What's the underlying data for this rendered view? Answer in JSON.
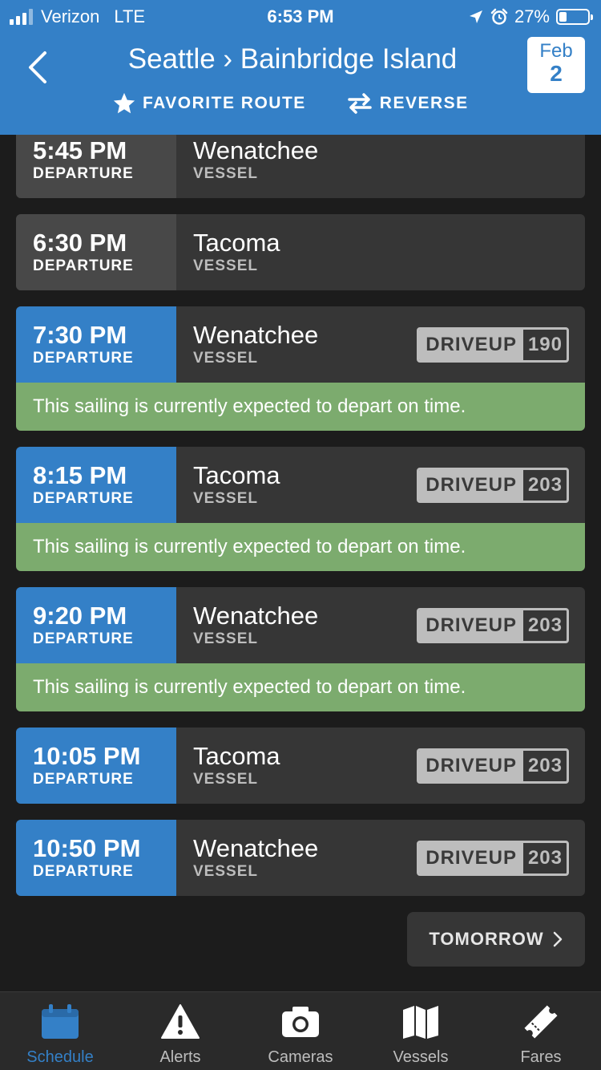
{
  "status_bar": {
    "carrier": "Verizon",
    "network": "LTE",
    "time": "6:53 PM",
    "battery": "27%",
    "battery_level": 0.27
  },
  "header": {
    "title": "Seattle › Bainbridge Island",
    "favorite_label": "FAVORITE ROUTE",
    "reverse_label": "REVERSE",
    "date_month": "Feb",
    "date_day": "2",
    "color": "#3480c7"
  },
  "sailings": [
    {
      "time": "5:45 PM",
      "dep_label": "DEPARTURE",
      "vessel": "Wenatchee",
      "vessel_label": "VESSEL",
      "upcoming": false,
      "driveup_label": "",
      "driveup_count": "",
      "status": ""
    },
    {
      "time": "6:30 PM",
      "dep_label": "DEPARTURE",
      "vessel": "Tacoma",
      "vessel_label": "VESSEL",
      "upcoming": false,
      "driveup_label": "",
      "driveup_count": "",
      "status": ""
    },
    {
      "time": "7:30 PM",
      "dep_label": "DEPARTURE",
      "vessel": "Wenatchee",
      "vessel_label": "VESSEL",
      "upcoming": true,
      "driveup_label": "DRIVEUP",
      "driveup_count": "190",
      "status": "This sailing is currently expected to depart on time."
    },
    {
      "time": "8:15 PM",
      "dep_label": "DEPARTURE",
      "vessel": "Tacoma",
      "vessel_label": "VESSEL",
      "upcoming": true,
      "driveup_label": "DRIVEUP",
      "driveup_count": "203",
      "status": "This sailing is currently expected to depart on time."
    },
    {
      "time": "9:20 PM",
      "dep_label": "DEPARTURE",
      "vessel": "Wenatchee",
      "vessel_label": "VESSEL",
      "upcoming": true,
      "driveup_label": "DRIVEUP",
      "driveup_count": "203",
      "status": "This sailing is currently expected to depart on time."
    },
    {
      "time": "10:05 PM",
      "dep_label": "DEPARTURE",
      "vessel": "Tacoma",
      "vessel_label": "VESSEL",
      "upcoming": true,
      "driveup_label": "DRIVEUP",
      "driveup_count": "203",
      "status": ""
    },
    {
      "time": "10:50 PM",
      "dep_label": "DEPARTURE",
      "vessel": "Wenatchee",
      "vessel_label": "VESSEL",
      "upcoming": true,
      "driveup_label": "DRIVEUP",
      "driveup_count": "203",
      "status": ""
    }
  ],
  "tomorrow_label": "TOMORROW",
  "tabs": [
    {
      "label": "Schedule",
      "icon": "calendar-icon",
      "active": true
    },
    {
      "label": "Alerts",
      "icon": "warning-icon",
      "active": false
    },
    {
      "label": "Cameras",
      "icon": "camera-icon",
      "active": false
    },
    {
      "label": "Vessels",
      "icon": "map-icon",
      "active": false
    },
    {
      "label": "Fares",
      "icon": "ticket-icon",
      "active": false
    }
  ],
  "colors": {
    "accent": "#3480c7",
    "on_time": "#7cab6e",
    "card": "#363636",
    "background": "#1c1c1c"
  }
}
